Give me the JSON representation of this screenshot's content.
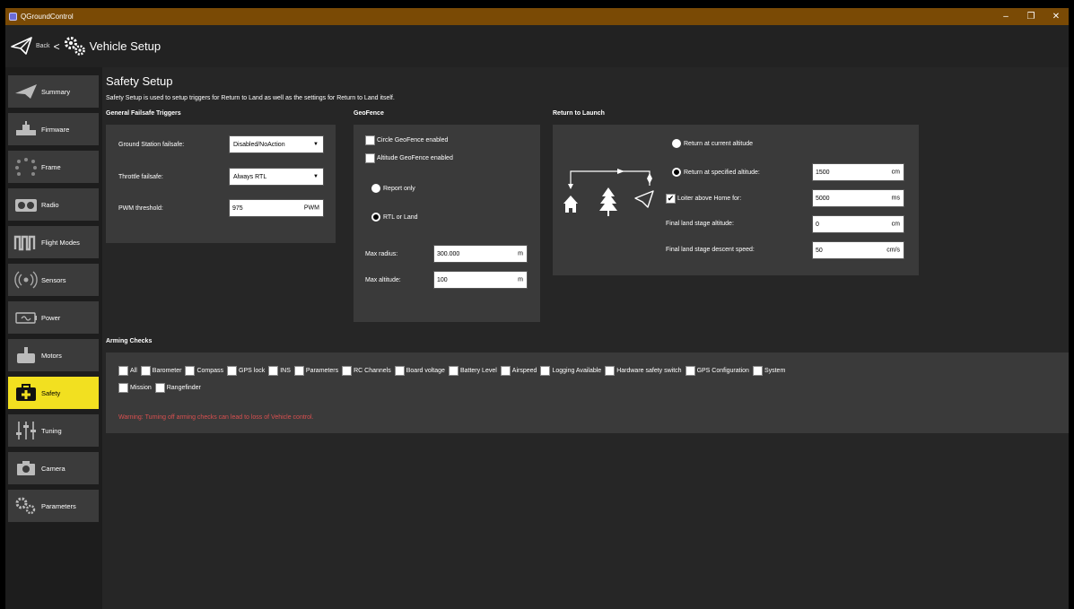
{
  "window": {
    "title": "QGroundControl",
    "minimize": "–",
    "maximize": "❐",
    "close": "✕"
  },
  "toolbar": {
    "back_label": "Back",
    "separator": "<",
    "page_title": "Vehicle Setup"
  },
  "sidebar": {
    "items": [
      {
        "label": "Summary",
        "icon": "paper-plane-icon"
      },
      {
        "label": "Firmware",
        "icon": "firmware-icon"
      },
      {
        "label": "Frame",
        "icon": "frame-icon"
      },
      {
        "label": "Radio",
        "icon": "radio-icon"
      },
      {
        "label": "Flight Modes",
        "icon": "flight-modes-icon"
      },
      {
        "label": "Sensors",
        "icon": "sensors-icon"
      },
      {
        "label": "Power",
        "icon": "power-icon"
      },
      {
        "label": "Motors",
        "icon": "motors-icon"
      },
      {
        "label": "Safety",
        "icon": "safety-icon"
      },
      {
        "label": "Tuning",
        "icon": "tuning-icon"
      },
      {
        "label": "Camera",
        "icon": "camera-icon"
      },
      {
        "label": "Parameters",
        "icon": "parameters-icon"
      }
    ],
    "active": "Safety",
    "active_color": "#f2e020"
  },
  "page": {
    "title": "Safety Setup",
    "description": "Safety Setup is used to setup triggers for Return to Land as well as the settings for Return to Land itself."
  },
  "failsafe": {
    "heading": "General Failsafe Triggers",
    "gcs_label": "Ground Station failsafe:",
    "gcs_value": "Disabled/NoAction",
    "throttle_label": "Throttle failsafe:",
    "throttle_value": "Always RTL",
    "pwm_label": "PWM threshold:",
    "pwm_value": "975",
    "pwm_unit": "PWM"
  },
  "geofence": {
    "heading": "GeoFence",
    "circle_label": "Circle GeoFence enabled",
    "circle_checked": false,
    "altitude_label": "Altitude GeoFence enabled",
    "altitude_checked": false,
    "report_only_label": "Report only",
    "rtl_land_label": "RTL or Land",
    "selected": "Report only",
    "max_radius_label": "Max radius:",
    "max_radius_value": "300.000",
    "max_radius_unit": "m",
    "max_alt_label": "Max altitude:",
    "max_alt_value": "100",
    "max_alt_unit": "m"
  },
  "rtl": {
    "heading": "Return to Launch",
    "current_alt_label": "Return at current altitude",
    "specified_alt_label": "Return at specified altitude:",
    "selected": "Return at current altitude",
    "specified_alt_value": "1500",
    "specified_alt_unit": "cm",
    "loiter_label": "Loiter above Home for:",
    "loiter_checked": true,
    "loiter_value": "5000",
    "loiter_unit": "ms",
    "final_alt_label": "Final land stage altitude:",
    "final_alt_value": "0",
    "final_alt_unit": "cm",
    "descent_label": "Final land stage descent speed:",
    "descent_value": "50",
    "descent_unit": "cm/s"
  },
  "arming": {
    "heading": "Arming Checks",
    "row1": [
      "All",
      "Barometer",
      "Compass",
      "GPS lock",
      "INS",
      "Parameters",
      "RC Channels",
      "Board voltage",
      "Battery Level",
      "Airspeed",
      "Logging Available",
      "Hardware safety switch",
      "GPS Configuration",
      "System"
    ],
    "row2": [
      "Mission",
      "Rangefinder"
    ],
    "warning": "Warning: Turning off arming checks can lead to loss of Vehicle control.",
    "warning_color": "#d95050"
  }
}
